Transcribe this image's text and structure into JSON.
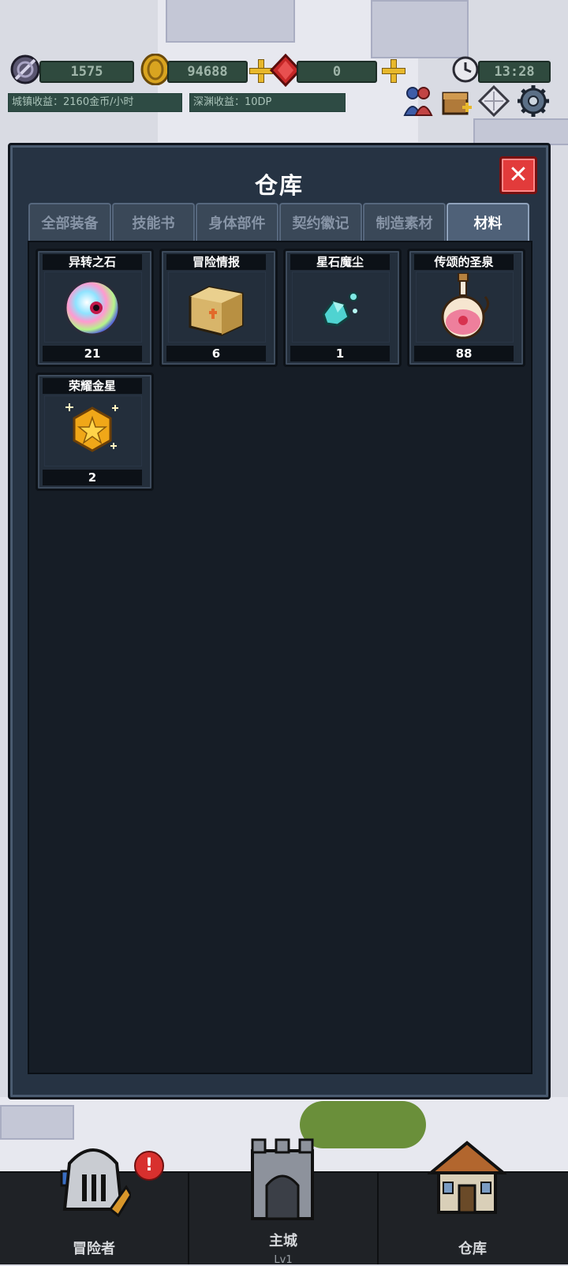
{
  "hud": {
    "energy": "1575",
    "gold": "94688",
    "gems": "0",
    "time": "13:28",
    "town_income": "城镇收益：2160金币/小时",
    "abyss_income": "深渊收益：10DP"
  },
  "panel": {
    "title": "仓库",
    "close_icon": "✕",
    "tabs": [
      {
        "label": "全部装备",
        "active": false
      },
      {
        "label": "技能书",
        "active": false
      },
      {
        "label": "身体部件",
        "active": false
      },
      {
        "label": "契约徽记",
        "active": false
      },
      {
        "label": "制造素材",
        "active": false
      },
      {
        "label": "材料",
        "active": true
      }
    ],
    "items": [
      {
        "name": "异转之石",
        "count": "21",
        "icon": "rainbow-orb-icon"
      },
      {
        "name": "冒险情报",
        "count": "6",
        "icon": "crate-icon"
      },
      {
        "name": "星石魔尘",
        "count": "1",
        "icon": "crystal-dust-icon"
      },
      {
        "name": "传颂的圣泉",
        "count": "88",
        "icon": "potion-icon"
      },
      {
        "name": "荣耀金星",
        "count": "2",
        "icon": "gold-star-icon"
      }
    ]
  },
  "nav": {
    "adventurer": "冒险者",
    "alert_mark": "!",
    "main_city": "主城",
    "main_city_level": "Lv1",
    "warehouse": "仓库"
  },
  "colors": {
    "panel_bg": "#263343",
    "content_bg": "#161d26",
    "close_red": "#e23b3b",
    "gold": "#e8b82c",
    "bar_green": "#2f4a3e"
  }
}
